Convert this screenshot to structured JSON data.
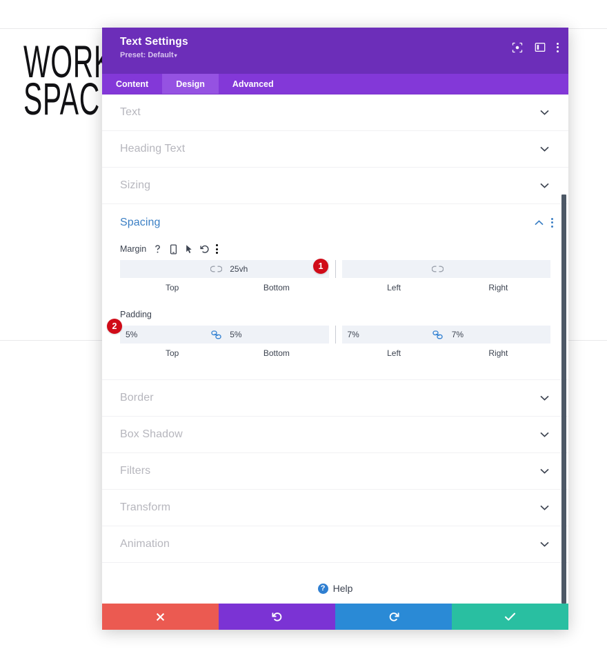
{
  "background": {
    "hero_text": "WORK\nSPACE"
  },
  "modal": {
    "title": "Text Settings",
    "preset_label": "Preset: Default",
    "preset_caret": "▾",
    "header_icons": [
      {
        "name": "focus-target-icon"
      },
      {
        "name": "split-view-icon"
      },
      {
        "name": "more-options-icon"
      }
    ],
    "tabs": [
      {
        "label": "Content",
        "active": false
      },
      {
        "label": "Design",
        "active": true
      },
      {
        "label": "Advanced",
        "active": false
      }
    ],
    "sections_above": [
      {
        "label": "Text"
      },
      {
        "label": "Heading Text"
      },
      {
        "label": "Sizing"
      }
    ],
    "spacing": {
      "label": "Spacing",
      "expanded": true,
      "margin": {
        "label": "Margin",
        "icons": [
          "help-icon",
          "responsive-mobile-icon",
          "hover-cursor-icon",
          "reset-icon",
          "more-options-icon"
        ],
        "link_left_state": "broken",
        "link_right_state": "broken",
        "fields": [
          {
            "caption": "Top",
            "value": ""
          },
          {
            "caption": "Bottom",
            "value": "25vh"
          },
          {
            "caption": "Left",
            "value": ""
          },
          {
            "caption": "Right",
            "value": ""
          }
        ]
      },
      "padding": {
        "label": "Padding",
        "link_left_state": "linked",
        "link_right_state": "linked",
        "fields": [
          {
            "caption": "Top",
            "value": "5%"
          },
          {
            "caption": "Bottom",
            "value": "5%"
          },
          {
            "caption": "Left",
            "value": "7%"
          },
          {
            "caption": "Right",
            "value": "7%"
          }
        ]
      }
    },
    "sections_below": [
      {
        "label": "Border"
      },
      {
        "label": "Box Shadow"
      },
      {
        "label": "Filters"
      },
      {
        "label": "Transform"
      },
      {
        "label": "Animation"
      }
    ],
    "help": {
      "label": "Help",
      "badge": "?"
    },
    "footer_buttons": [
      {
        "name": "cancel-button",
        "glyph": "✕",
        "color": "#eb5a51"
      },
      {
        "name": "undo-button",
        "glyph": "↺",
        "color": "#7b33d4"
      },
      {
        "name": "redo-button",
        "glyph": "↻",
        "color": "#2a8ad6"
      },
      {
        "name": "save-button",
        "glyph": "✔",
        "color": "#29bfa1"
      }
    ]
  },
  "annotations": [
    {
      "number": "1",
      "target": "margin-bottom-field"
    },
    {
      "number": "2",
      "target": "padding-top-field"
    }
  ],
  "colors": {
    "header_purple": "#6c2eb9",
    "tabs_purple": "#8338d8",
    "tab_active_purple": "#9552e2",
    "accent_blue": "#3b7fc4",
    "link_blue": "#2f7fd1",
    "badge_red": "#d00b18",
    "field_bg": "#eff2f7",
    "muted_label": "#b6b6bd"
  }
}
